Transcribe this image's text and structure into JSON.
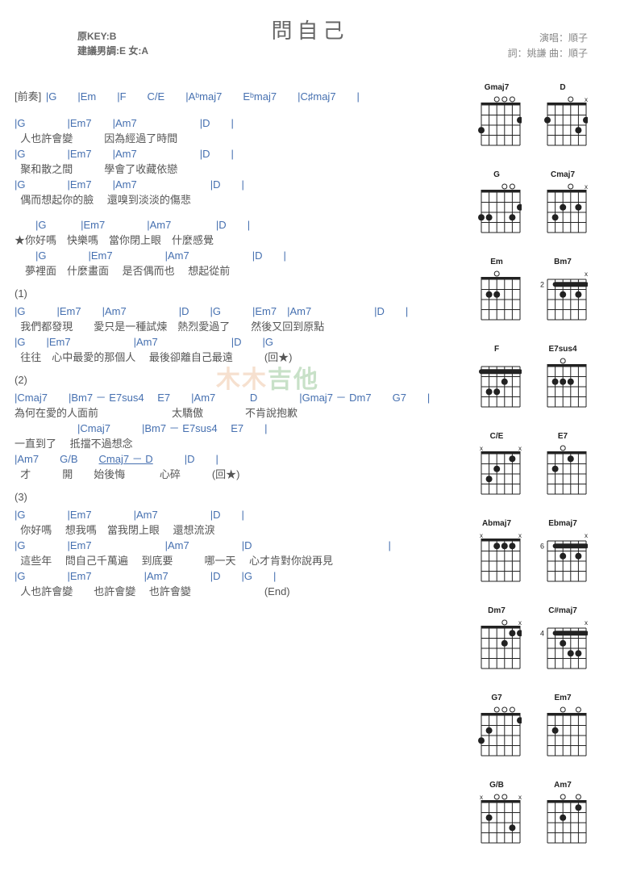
{
  "title": "問自己",
  "meta_left": {
    "l1": "原KEY:B",
    "l2": "建議男調:E 女:A"
  },
  "meta_right": {
    "l1": "演唱：順子",
    "l2": "詞：姚謙 曲：順子"
  },
  "intro": {
    "label": "[前奏]",
    "chords": "|G　　|Em　　|F　　C/E　　|Aᵇmaj7　　Eᵇmaj7　　|C♯maj7　　|"
  },
  "watermark": {
    "p1": "木木",
    "p2": "吉他"
  },
  "verse1": [
    {
      "c": "|G　　　　|Em7　　|Am7　　　　　　|D　　|",
      "l": "  人也許會變　　　因為經過了時間"
    },
    {
      "c": "|G　　　　|Em7　　|Am7　　　　　　|D　　|",
      "l": "  聚和散之間　　　學會了收藏依戀"
    },
    {
      "c": "|G　　　　|Em7　　|Am7　　　　　　　|D　　|",
      "l": "  偶而想起你的臉　 還嗅到淡淡的傷悲"
    }
  ],
  "pre": [
    {
      "c": "　　|G　　　 |Em7　　　　|Am7　　　　 |D　　|",
      "l": "★你好嗎　快樂嗎　當你閉上眼　什麼感覺"
    },
    {
      "c": "　　|G　　　　|Em7　　　　　|Am7　　　　　　|D　　|",
      "l": "　夢裡面　什麼畫面　 是否偶而也　 想起從前"
    }
  ],
  "s1_label": "(1)",
  "s1": [
    {
      "c": "|G　　　|Em7　　|Am7　　　　　|D　　|G　　　|Em7　|Am7　　　　　　|D　　|",
      "l": "  我們都發現　　愛只是一種試煉　熱烈愛過了　　然後又回到原點"
    },
    {
      "c": "|G　　|Em7　　　　　　|Am7　　　　　　　|D　　|G　　",
      "l": "  往往　心中最愛的那個人　 最後卻離自己最遠　　　(回★)"
    }
  ],
  "s2_label": "(2)",
  "s2": [
    {
      "c": "|Cmaj7　　|Bm7 － E7sus4　 E7　　|Am7　　　 D　　　　|Gmaj7 － Dm7　　G7　　|",
      "l": "為何在愛的人面前　　　　　　　太驕傲　　　　不肯說抱歉"
    },
    {
      "c": "　　　　　　|Cmaj7　　　|Bm7 － E7sus4　 E7　　|",
      "l": "一直到了　 抵擋不過想念"
    },
    {
      "c": "|Am7　　G/B　　",
      "cu": "Cmaj7 － D",
      "c2": "　　　|D　　|",
      "l": "  才　　　開　　始後悔　　　 心碎　　　(回★)"
    }
  ],
  "s3_label": "(3)",
  "s3": [
    {
      "c": "|G　　　　|Em7　　　　|Am7　　　　　|D　　|",
      "l": "  你好嗎　 想我嗎　當我閉上眼　 還想流淚"
    },
    {
      "c": "|G　　　　|Em7　　　　　　　|Am7　　　　　|D　　　　　　　　　　　　　|",
      "l": "  這些年　 問自己千萬遍　 到底要　　　哪一天　 心才肯對你說再見"
    },
    {
      "c": "|G　　　　|Em7　　　　　|Am7　　　　|D　　|G　　|",
      "l": "  人也許會變　　也許會變　 也許會變　　　　　　　(End)"
    }
  ],
  "diagrams": [
    {
      "name": "Gmaj7",
      "fret": "",
      "nut": true,
      "x": [
        0,
        0,
        0,
        0,
        0,
        0
      ],
      "o": [
        0,
        1,
        1,
        1,
        0,
        0
      ],
      "dots": [
        [
          2,
          1
        ],
        [
          3,
          6
        ]
      ],
      "barre": null
    },
    {
      "name": "D",
      "fret": "",
      "nut": true,
      "x": [
        1,
        0,
        0,
        0,
        0,
        0
      ],
      "o": [
        0,
        0,
        1,
        0,
        0,
        0
      ],
      "dots": [
        [
          2,
          1
        ],
        [
          2,
          6
        ],
        [
          3,
          2
        ]
      ],
      "barre": null
    },
    {
      "name": "G",
      "fret": "",
      "nut": true,
      "x": [
        0,
        0,
        0,
        0,
        0,
        0
      ],
      "o": [
        0,
        1,
        1,
        0,
        0,
        0
      ],
      "dots": [
        [
          2,
          1
        ],
        [
          3,
          6
        ],
        [
          3,
          2
        ],
        [
          3,
          5
        ]
      ],
      "barre": null
    },
    {
      "name": "Cmaj7",
      "fret": "",
      "nut": true,
      "x": [
        1,
        0,
        0,
        0,
        0,
        0
      ],
      "o": [
        0,
        0,
        1,
        0,
        0,
        0
      ],
      "dots": [
        [
          2,
          4
        ],
        [
          3,
          5
        ],
        [
          2,
          2
        ]
      ],
      "barre": null
    },
    {
      "name": "Em",
      "fret": "",
      "nut": true,
      "x": [
        0,
        0,
        0,
        0,
        0,
        0
      ],
      "o": [
        0,
        0,
        0,
        1,
        0,
        0
      ],
      "dots": [
        [
          2,
          5
        ],
        [
          2,
          4
        ]
      ],
      "barre": null
    },
    {
      "name": "Bm7",
      "fret": "2",
      "nut": false,
      "x": [
        1,
        0,
        0,
        0,
        0,
        0
      ],
      "o": [
        0,
        0,
        0,
        0,
        0,
        0
      ],
      "dots": [
        [
          2,
          4
        ],
        [
          2,
          2
        ]
      ],
      "barre": {
        "f": 1,
        "from": 1,
        "to": 5
      }
    },
    {
      "name": "F",
      "fret": "",
      "nut": false,
      "x": [
        0,
        0,
        0,
        0,
        0,
        0
      ],
      "o": [
        0,
        0,
        0,
        0,
        0,
        0
      ],
      "dots": [
        [
          2,
          3
        ],
        [
          3,
          5
        ],
        [
          3,
          4
        ]
      ],
      "barre": {
        "f": 1,
        "from": 1,
        "to": 6
      }
    },
    {
      "name": "E7sus4",
      "fret": "",
      "nut": true,
      "x": [
        0,
        0,
        0,
        0,
        0,
        0
      ],
      "o": [
        0,
        0,
        0,
        1,
        0,
        0
      ],
      "dots": [
        [
          2,
          5
        ],
        [
          2,
          4
        ],
        [
          2,
          3
        ]
      ],
      "barre": null
    },
    {
      "name": "C/E",
      "fret": "",
      "nut": true,
      "x": [
        1,
        0,
        0,
        0,
        0,
        1
      ],
      "o": [
        0,
        0,
        0,
        0,
        0,
        0
      ],
      "dots": [
        [
          1,
          2
        ],
        [
          2,
          4
        ],
        [
          3,
          5
        ]
      ],
      "barre": null
    },
    {
      "name": "E7",
      "fret": "",
      "nut": true,
      "x": [
        0,
        0,
        0,
        0,
        0,
        0
      ],
      "o": [
        0,
        0,
        0,
        1,
        0,
        0
      ],
      "dots": [
        [
          1,
          3
        ],
        [
          2,
          5
        ]
      ],
      "barre": null
    },
    {
      "name": "Abmaj7",
      "fret": "",
      "nut": true,
      "x": [
        1,
        0,
        0,
        0,
        0,
        1
      ],
      "o": [
        0,
        0,
        0,
        0,
        0,
        0
      ],
      "dots": [
        [
          1,
          4
        ],
        [
          1,
          3
        ],
        [
          1,
          2
        ]
      ],
      "barre": null
    },
    {
      "name": "Ebmaj7",
      "fret": "6",
      "nut": false,
      "x": [
        1,
        0,
        0,
        0,
        0,
        0
      ],
      "o": [
        0,
        0,
        0,
        0,
        0,
        0
      ],
      "dots": [
        [
          2,
          4
        ],
        [
          2,
          2
        ]
      ],
      "barre": {
        "f": 1,
        "from": 1,
        "to": 5
      }
    },
    {
      "name": "Dm7",
      "fret": "",
      "nut": true,
      "x": [
        1,
        0,
        0,
        0,
        0,
        0
      ],
      "o": [
        0,
        0,
        1,
        0,
        0,
        0
      ],
      "dots": [
        [
          1,
          1
        ],
        [
          1,
          2
        ],
        [
          2,
          3
        ]
      ],
      "barre": null
    },
    {
      "name": "C#maj7",
      "fret": "4",
      "nut": false,
      "x": [
        1,
        0,
        0,
        0,
        0,
        0
      ],
      "o": [
        0,
        0,
        0,
        0,
        0,
        0
      ],
      "dots": [
        [
          2,
          4
        ],
        [
          3,
          3
        ],
        [
          3,
          2
        ]
      ],
      "barre": {
        "f": 1,
        "from": 1,
        "to": 5
      }
    },
    {
      "name": "G7",
      "fret": "",
      "nut": true,
      "x": [
        0,
        0,
        0,
        0,
        0,
        0
      ],
      "o": [
        0,
        1,
        1,
        1,
        0,
        0
      ],
      "dots": [
        [
          1,
          1
        ],
        [
          2,
          5
        ],
        [
          3,
          6
        ]
      ],
      "barre": null
    },
    {
      "name": "Em7",
      "fret": "",
      "nut": true,
      "x": [
        0,
        0,
        0,
        0,
        0,
        0
      ],
      "o": [
        0,
        1,
        0,
        1,
        0,
        0
      ],
      "dots": [
        [
          2,
          5
        ]
      ],
      "barre": null
    },
    {
      "name": "G/B",
      "fret": "",
      "nut": true,
      "x": [
        1,
        0,
        0,
        0,
        0,
        1
      ],
      "o": [
        0,
        0,
        1,
        1,
        0,
        0
      ],
      "dots": [
        [
          2,
          5
        ],
        [
          3,
          2
        ]
      ],
      "barre": null
    },
    {
      "name": "Am7",
      "fret": "",
      "nut": true,
      "x": [
        0,
        0,
        0,
        0,
        0,
        0
      ],
      "o": [
        0,
        1,
        0,
        1,
        0,
        0
      ],
      "dots": [
        [
          1,
          2
        ],
        [
          2,
          4
        ]
      ],
      "barre": null
    }
  ]
}
